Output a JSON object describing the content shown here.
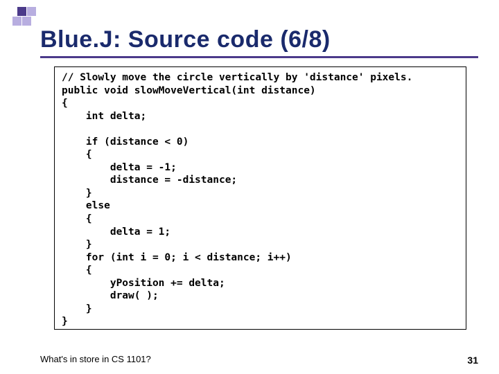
{
  "title": "Blue.J: Source code (6/8)",
  "code": {
    "l01": "// Slowly move the circle vertically by 'distance' pixels.",
    "l02": "public void slowMoveVertical(int distance)",
    "l03": "{",
    "l04": "    int delta;",
    "l05": "",
    "l06": "    if (distance < 0)",
    "l07": "    {",
    "l08": "        delta = -1;",
    "l09": "        distance = -distance;",
    "l10": "    }",
    "l11": "    else",
    "l12": "    {",
    "l13": "        delta = 1;",
    "l14": "    }",
    "l15": "    for (int i = 0; i < distance; i++)",
    "l16": "    {",
    "l17": "        yPosition += delta;",
    "l18": "        draw( );",
    "l19": "    }",
    "l20": "}"
  },
  "footer": {
    "left": "What's in store in CS 1101?",
    "right": "31"
  }
}
